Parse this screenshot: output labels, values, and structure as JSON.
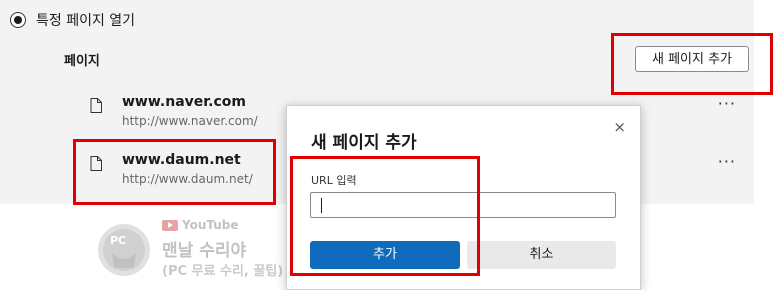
{
  "settings": {
    "radio_label": "특정 페이지 열기",
    "pages_label": "페이지",
    "add_page_button": "새 페이지 추가",
    "pages": [
      {
        "name": "www.naver.com",
        "url": "http://www.naver.com/"
      },
      {
        "name": "www.daum.net",
        "url": "http://www.daum.net/"
      }
    ],
    "more_icon": "more-horizontal-icon"
  },
  "dialog": {
    "title": "새 페이지 추가",
    "close_glyph": "×",
    "url_label": "URL 입력",
    "url_value": "",
    "add_button": "추가",
    "cancel_button": "취소"
  },
  "watermark": {
    "youtube": "YouTube",
    "name": "맨날 수리야",
    "subtitle": "(PC 무료 수리, 꿀팁)",
    "logo_text": "PC"
  },
  "colors": {
    "highlight": "#e00000",
    "primary_button": "#0f6cbd",
    "settings_background": "#f3f3f3"
  }
}
